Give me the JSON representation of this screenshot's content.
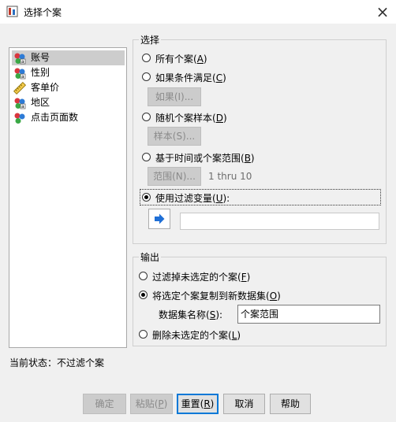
{
  "window": {
    "title": "选择个案",
    "close": "×"
  },
  "variables": [
    {
      "label": "账号",
      "icon": "nominal-variable-icon"
    },
    {
      "label": "性别",
      "icon": "nominal-variable-icon"
    },
    {
      "label": "客单价",
      "icon": "scale-variable-icon"
    },
    {
      "label": "地区",
      "icon": "nominal-variable-icon"
    },
    {
      "label": "点击页面数",
      "icon": "nominal-variable-icon"
    }
  ],
  "select": {
    "legend": "选择",
    "all_cases": {
      "text": "所有个案(",
      "key": "A",
      "tail": ")"
    },
    "if_condition": {
      "text": "如果条件满足(",
      "key": "C",
      "tail": ")"
    },
    "if_button": "如果(I)...",
    "random_sample": {
      "text": "随机个案样本(",
      "key": "D",
      "tail": ")"
    },
    "sample_button": "样本(S)...",
    "time_range": {
      "text": "基于时间或个案范围(",
      "key": "B",
      "tail": ")"
    },
    "range_button": "范围(N)...",
    "range_value": "1 thru 10",
    "filter_var": {
      "text": "使用过滤变量(",
      "key": "U",
      "tail": "):"
    },
    "filter_value": ""
  },
  "output": {
    "legend": "输出",
    "filter_out": {
      "text": "过滤掉未选定的个案(",
      "key": "F",
      "tail": ")"
    },
    "copy_new": {
      "text": "将选定个案复制到新数据集(",
      "key": "O",
      "tail": ")"
    },
    "dataset_label": {
      "text": "数据集名称(",
      "key": "S",
      "tail": "):"
    },
    "dataset_value": "个案范围",
    "delete": {
      "text": "删除未选定的个案(",
      "key": "L",
      "tail": ")"
    }
  },
  "status": "当前状态：不过滤个案",
  "buttons": {
    "ok": "确定",
    "paste": {
      "text": "粘贴(",
      "key": "P",
      "tail": ")"
    },
    "reset": {
      "text": "重置(",
      "key": "R",
      "tail": ")"
    },
    "cancel": "取消",
    "help": "帮助"
  },
  "colors": {
    "accent": "#0078d7",
    "arrow": "#1f6fd6",
    "selected_bg": "#cdcdcd"
  }
}
